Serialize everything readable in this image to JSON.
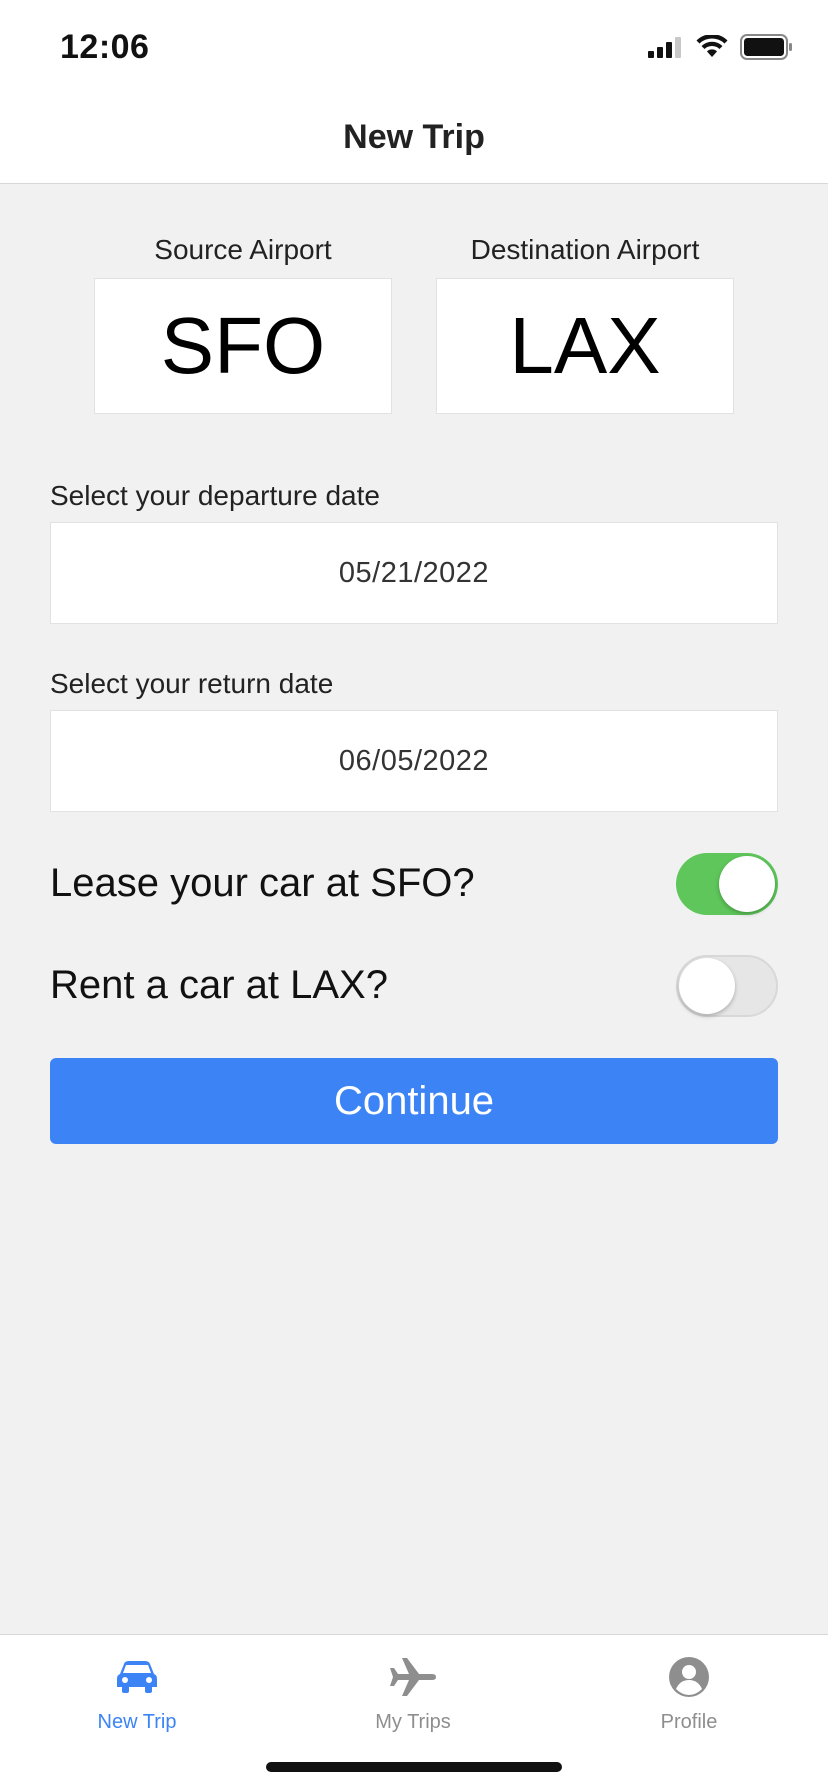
{
  "status_bar": {
    "time": "12:06"
  },
  "nav": {
    "title": "New Trip"
  },
  "airports": {
    "source_label": "Source Airport",
    "source_code": "SFO",
    "destination_label": "Destination Airport",
    "destination_code": "LAX"
  },
  "departure": {
    "label": "Select your departure date",
    "value": "05/21/2022"
  },
  "return_date": {
    "label": "Select your return date",
    "value": "06/05/2022"
  },
  "options": {
    "lease_label": "Lease your car at SFO?",
    "lease_on": true,
    "rent_label": "Rent a car at LAX?",
    "rent_on": false
  },
  "continue_label": "Continue",
  "tabs": [
    {
      "label": "New Trip",
      "icon": "car-icon",
      "active": true
    },
    {
      "label": "My Trips",
      "icon": "airplane-icon",
      "active": false
    },
    {
      "label": "Profile",
      "icon": "person-icon",
      "active": false
    }
  ],
  "colors": {
    "accent": "#3c84f6",
    "toggle_on": "#5ec65a",
    "background": "#f1f1f1",
    "inactive_tab": "#8e8e8e"
  }
}
